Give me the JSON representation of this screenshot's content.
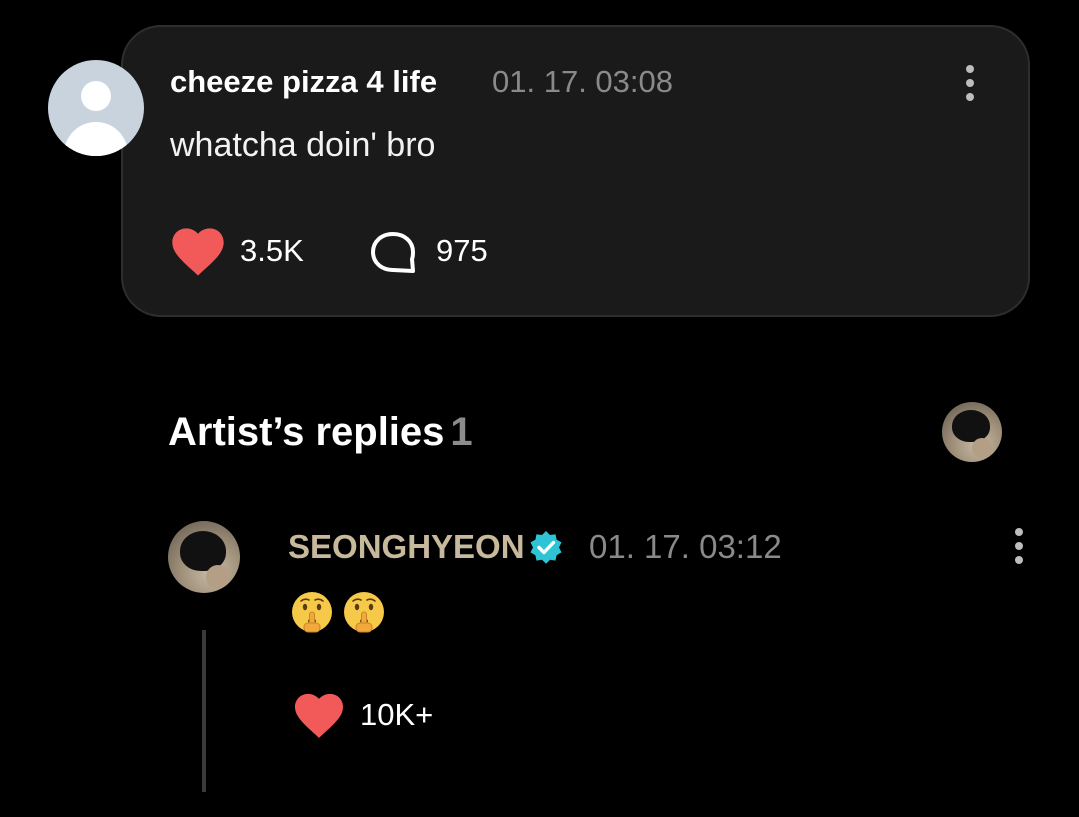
{
  "comment": {
    "username": "cheeze pizza 4 life",
    "timestamp": "01. 17. 03:08",
    "text": "whatcha doin' bro",
    "likes": "3.5K",
    "replies": "975"
  },
  "artist_replies": {
    "title": "Artist’s replies",
    "count": "1"
  },
  "reply": {
    "username": "SEONGHYEON",
    "timestamp": "01. 17. 03:12",
    "emojis": [
      "shushing-face",
      "shushing-face"
    ],
    "likes": "10K+"
  },
  "colors": {
    "background": "#000000",
    "card": "#1a1a1a",
    "heart": "#f25a5a",
    "artist_name": "#c7b99c",
    "verified": "#2ec4d6",
    "muted_text": "#8a8a8a"
  }
}
